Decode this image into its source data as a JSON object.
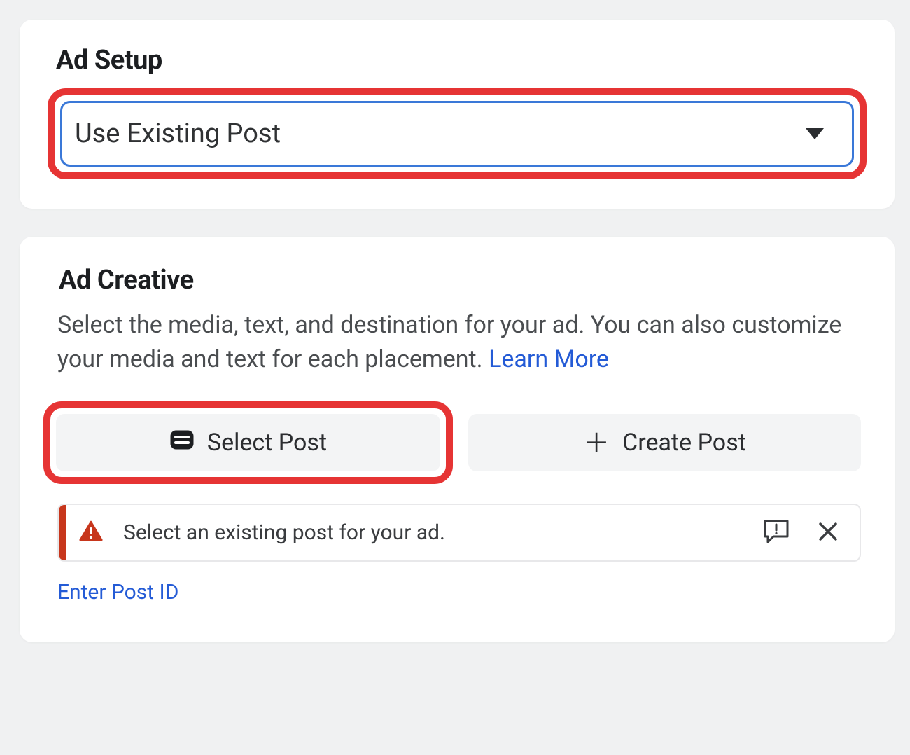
{
  "ad_setup": {
    "title": "Ad Setup",
    "dropdown_value": "Use Existing Post"
  },
  "ad_creative": {
    "title": "Ad Creative",
    "description": "Select the media, text, and destination for your ad. You can also customize your media and text for each placement. ",
    "learn_more_label": "Learn More",
    "select_post_label": "Select Post",
    "create_post_label": "Create Post",
    "alert_message": "Select an existing post for your ad.",
    "enter_post_id_label": "Enter Post ID"
  },
  "colors": {
    "highlight": "#e63434",
    "link": "#245bd6",
    "warning": "#c7361c"
  }
}
